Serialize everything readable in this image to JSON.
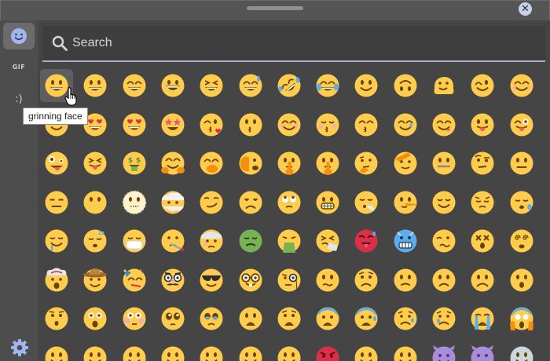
{
  "window": {
    "close_label": "✕"
  },
  "sidebar": {
    "tabs": [
      {
        "name": "emoji",
        "icon": "smiley-face-icon",
        "active": true
      },
      {
        "name": "gif",
        "label": "GIF",
        "active": false
      },
      {
        "name": "kaomoji",
        "label": ":)",
        "active": false
      }
    ],
    "settings_icon": "gear-icon"
  },
  "search": {
    "placeholder": "Search",
    "value": ""
  },
  "tooltip": {
    "text": "grinning face"
  },
  "emoji_grid": {
    "hovered_index": 0,
    "rows": [
      [
        "grinning",
        "grinning",
        "beaming",
        "big-grin",
        "laughing",
        "grin-sweat",
        "rofl",
        "tears-of-joy",
        "slight-smile",
        "upside-down",
        "melting",
        "winking",
        "blush"
      ],
      [
        "halo",
        "heart-eyes",
        "heart-eyes",
        "star-struck",
        "kissing-heart",
        "kissing",
        "smiling-blush",
        "kissing-closed-eyes",
        "kissing-smiling",
        "smiling-tear",
        "yum",
        "tongue",
        "winking-tongue"
      ],
      [
        "zany",
        "squint-tongue",
        "money-mouth",
        "hugging",
        "hand-over-mouth",
        "peeking",
        "shushing",
        "shushing",
        "thinking",
        "saluting",
        "zipper",
        "raised-eyebrow",
        "neutral"
      ],
      [
        "expressionless",
        "no-mouth",
        "dotted-line",
        "face-in-clouds",
        "smirking",
        "unamused",
        "eye-roll",
        "grimacing",
        "exhaling",
        "lying",
        "relieved",
        "pensive",
        "sleepy"
      ],
      [
        "drooling",
        "sleeping",
        "mask",
        "thermometer",
        "bandage",
        "nauseated",
        "vomiting",
        "sneezing",
        "hot",
        "cold",
        "woozy",
        "dizzy",
        "spiral-eyes"
      ],
      [
        "exploding",
        "cowboy",
        "partying",
        "disguised",
        "sunglasses",
        "nerd",
        "monocle",
        "confused",
        "worried",
        "slight-frown",
        "frowning",
        "frowning2",
        "open-mouth"
      ],
      [
        "hushed",
        "astonished",
        "flushed",
        "pleading",
        "holding-tears",
        "frowning-open",
        "anguished",
        "fearful",
        "anxious-sweat",
        "sad-relieved",
        "crying",
        "loud-crying",
        "screaming"
      ],
      [
        "confounded",
        "persevering",
        "disappointed",
        "downcast",
        "weary",
        "tired",
        "yawning",
        "angry-red",
        "pouting",
        "cursing",
        "smiling-horns",
        "angry-horns",
        "skull"
      ]
    ]
  }
}
